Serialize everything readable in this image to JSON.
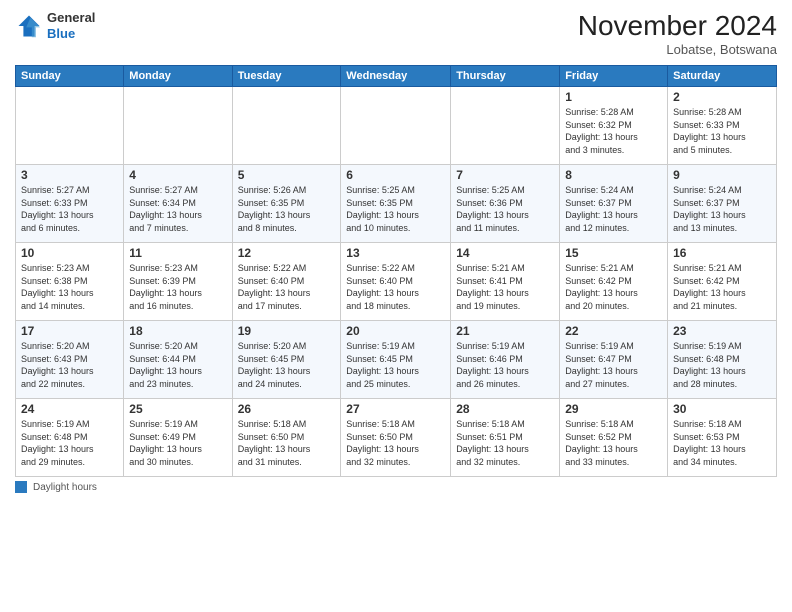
{
  "header": {
    "logo": {
      "general": "General",
      "blue": "Blue"
    },
    "title": "November 2024",
    "location": "Lobatse, Botswana"
  },
  "days_of_week": [
    "Sunday",
    "Monday",
    "Tuesday",
    "Wednesday",
    "Thursday",
    "Friday",
    "Saturday"
  ],
  "weeks": [
    [
      {
        "day": "",
        "info": ""
      },
      {
        "day": "",
        "info": ""
      },
      {
        "day": "",
        "info": ""
      },
      {
        "day": "",
        "info": ""
      },
      {
        "day": "",
        "info": ""
      },
      {
        "day": "1",
        "info": "Sunrise: 5:28 AM\nSunset: 6:32 PM\nDaylight: 13 hours\nand 3 minutes."
      },
      {
        "day": "2",
        "info": "Sunrise: 5:28 AM\nSunset: 6:33 PM\nDaylight: 13 hours\nand 5 minutes."
      }
    ],
    [
      {
        "day": "3",
        "info": "Sunrise: 5:27 AM\nSunset: 6:33 PM\nDaylight: 13 hours\nand 6 minutes."
      },
      {
        "day": "4",
        "info": "Sunrise: 5:27 AM\nSunset: 6:34 PM\nDaylight: 13 hours\nand 7 minutes."
      },
      {
        "day": "5",
        "info": "Sunrise: 5:26 AM\nSunset: 6:35 PM\nDaylight: 13 hours\nand 8 minutes."
      },
      {
        "day": "6",
        "info": "Sunrise: 5:25 AM\nSunset: 6:35 PM\nDaylight: 13 hours\nand 10 minutes."
      },
      {
        "day": "7",
        "info": "Sunrise: 5:25 AM\nSunset: 6:36 PM\nDaylight: 13 hours\nand 11 minutes."
      },
      {
        "day": "8",
        "info": "Sunrise: 5:24 AM\nSunset: 6:37 PM\nDaylight: 13 hours\nand 12 minutes."
      },
      {
        "day": "9",
        "info": "Sunrise: 5:24 AM\nSunset: 6:37 PM\nDaylight: 13 hours\nand 13 minutes."
      }
    ],
    [
      {
        "day": "10",
        "info": "Sunrise: 5:23 AM\nSunset: 6:38 PM\nDaylight: 13 hours\nand 14 minutes."
      },
      {
        "day": "11",
        "info": "Sunrise: 5:23 AM\nSunset: 6:39 PM\nDaylight: 13 hours\nand 16 minutes."
      },
      {
        "day": "12",
        "info": "Sunrise: 5:22 AM\nSunset: 6:40 PM\nDaylight: 13 hours\nand 17 minutes."
      },
      {
        "day": "13",
        "info": "Sunrise: 5:22 AM\nSunset: 6:40 PM\nDaylight: 13 hours\nand 18 minutes."
      },
      {
        "day": "14",
        "info": "Sunrise: 5:21 AM\nSunset: 6:41 PM\nDaylight: 13 hours\nand 19 minutes."
      },
      {
        "day": "15",
        "info": "Sunrise: 5:21 AM\nSunset: 6:42 PM\nDaylight: 13 hours\nand 20 minutes."
      },
      {
        "day": "16",
        "info": "Sunrise: 5:21 AM\nSunset: 6:42 PM\nDaylight: 13 hours\nand 21 minutes."
      }
    ],
    [
      {
        "day": "17",
        "info": "Sunrise: 5:20 AM\nSunset: 6:43 PM\nDaylight: 13 hours\nand 22 minutes."
      },
      {
        "day": "18",
        "info": "Sunrise: 5:20 AM\nSunset: 6:44 PM\nDaylight: 13 hours\nand 23 minutes."
      },
      {
        "day": "19",
        "info": "Sunrise: 5:20 AM\nSunset: 6:45 PM\nDaylight: 13 hours\nand 24 minutes."
      },
      {
        "day": "20",
        "info": "Sunrise: 5:19 AM\nSunset: 6:45 PM\nDaylight: 13 hours\nand 25 minutes."
      },
      {
        "day": "21",
        "info": "Sunrise: 5:19 AM\nSunset: 6:46 PM\nDaylight: 13 hours\nand 26 minutes."
      },
      {
        "day": "22",
        "info": "Sunrise: 5:19 AM\nSunset: 6:47 PM\nDaylight: 13 hours\nand 27 minutes."
      },
      {
        "day": "23",
        "info": "Sunrise: 5:19 AM\nSunset: 6:48 PM\nDaylight: 13 hours\nand 28 minutes."
      }
    ],
    [
      {
        "day": "24",
        "info": "Sunrise: 5:19 AM\nSunset: 6:48 PM\nDaylight: 13 hours\nand 29 minutes."
      },
      {
        "day": "25",
        "info": "Sunrise: 5:19 AM\nSunset: 6:49 PM\nDaylight: 13 hours\nand 30 minutes."
      },
      {
        "day": "26",
        "info": "Sunrise: 5:18 AM\nSunset: 6:50 PM\nDaylight: 13 hours\nand 31 minutes."
      },
      {
        "day": "27",
        "info": "Sunrise: 5:18 AM\nSunset: 6:50 PM\nDaylight: 13 hours\nand 32 minutes."
      },
      {
        "day": "28",
        "info": "Sunrise: 5:18 AM\nSunset: 6:51 PM\nDaylight: 13 hours\nand 32 minutes."
      },
      {
        "day": "29",
        "info": "Sunrise: 5:18 AM\nSunset: 6:52 PM\nDaylight: 13 hours\nand 33 minutes."
      },
      {
        "day": "30",
        "info": "Sunrise: 5:18 AM\nSunset: 6:53 PM\nDaylight: 13 hours\nand 34 minutes."
      }
    ]
  ],
  "legend": {
    "label": "Daylight hours"
  }
}
